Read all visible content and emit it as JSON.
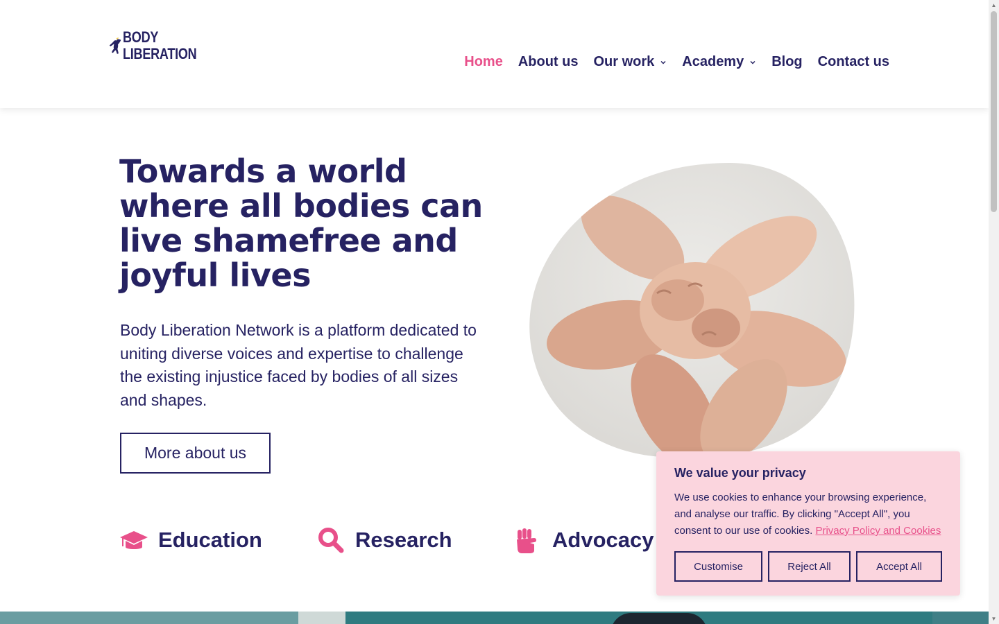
{
  "brand": {
    "logo_line1": "BODY",
    "logo_line2": "LIBERATION",
    "primary_color": "#262262",
    "accent_color": "#e8508a",
    "cookie_bg": "#fbd5de"
  },
  "nav": {
    "items": [
      {
        "label": "Home",
        "active": true,
        "has_dropdown": false
      },
      {
        "label": "About us",
        "active": false,
        "has_dropdown": false
      },
      {
        "label": "Our work",
        "active": false,
        "has_dropdown": true
      },
      {
        "label": "Academy",
        "active": false,
        "has_dropdown": true
      },
      {
        "label": "Blog",
        "active": false,
        "has_dropdown": false
      },
      {
        "label": "Contact us",
        "active": false,
        "has_dropdown": false
      }
    ]
  },
  "hero": {
    "title": "Towards a world where all bodies can live shamefree and joyful lives",
    "description": "Body Liberation Network is a platform dedicated to uniting diverse voices and expertise to challenge the existing injustice faced by bodies of all sizes and shapes.",
    "button_label": "More about us",
    "image_subject": "hands-fist-bump-photo"
  },
  "features": [
    {
      "label": "Education",
      "icon": "graduation-cap-icon"
    },
    {
      "label": "Research",
      "icon": "magnifier-icon"
    },
    {
      "label": "Advocacy",
      "icon": "raised-fist-icon"
    }
  ],
  "cookie": {
    "title": "We value your privacy",
    "text": "We use cookies to enhance your browsing experience, and analyse our traffic. By clicking \"Accept All\", you consent to our use of cookies.",
    "link_text": "Privacy Policy and Cookies",
    "buttons": {
      "customise": "Customise",
      "reject": "Reject All",
      "accept": "Accept All"
    }
  }
}
